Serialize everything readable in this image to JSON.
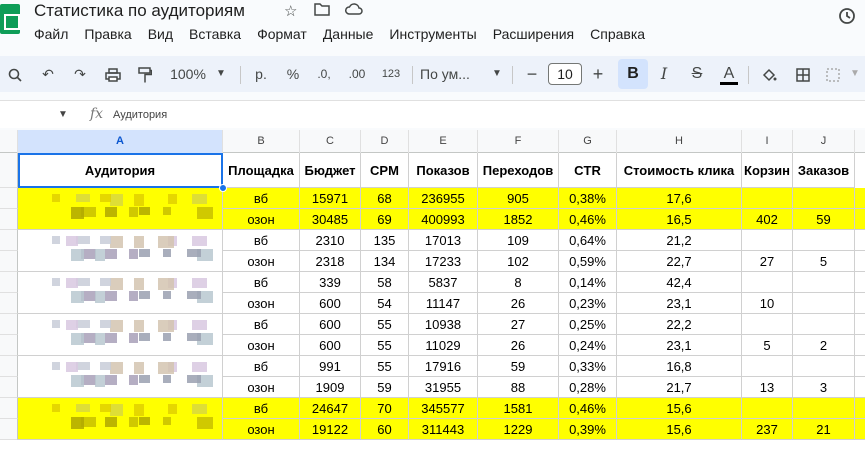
{
  "title": "Статистика по аудиториям",
  "menu": [
    "Файл",
    "Правка",
    "Вид",
    "Вставка",
    "Формат",
    "Данные",
    "Инструменты",
    "Расширения",
    "Справка"
  ],
  "toolbar": {
    "zoom": "100%",
    "currency": "р.",
    "percent": "%",
    "dec_decrease": ".0,",
    "dec_increase": ".00",
    "format_123": "123",
    "font": "По ум...",
    "font_size": "10",
    "bold": "B",
    "italic": "I",
    "strike": "S",
    "text_color": "A"
  },
  "formula_bar": {
    "value": "Аудитория"
  },
  "columns": [
    "A",
    "B",
    "C",
    "D",
    "E",
    "F",
    "G",
    "H",
    "I",
    "J"
  ],
  "selected_column": "A",
  "header_row": [
    "Аудитория",
    "Площадка",
    "Бюджет",
    "CPM",
    "Показов",
    "Переходов",
    "CTR",
    "Стоимость клика",
    "Корзин",
    "Заказов"
  ],
  "rows": [
    {
      "platform": "вб",
      "budget": "15971",
      "cpm": "68",
      "shows": "236955",
      "clicks": "905",
      "ctr": "0,38%",
      "cpc": "17,6",
      "carts": "",
      "orders": "",
      "highlight": true
    },
    {
      "platform": "озон",
      "budget": "30485",
      "cpm": "69",
      "shows": "400993",
      "clicks": "1852",
      "ctr": "0,46%",
      "cpc": "16,5",
      "carts": "402",
      "orders": "59",
      "highlight": true
    },
    {
      "platform": "вб",
      "budget": "2310",
      "cpm": "135",
      "shows": "17013",
      "clicks": "109",
      "ctr": "0,64%",
      "cpc": "21,2",
      "carts": "",
      "orders": "",
      "highlight": false
    },
    {
      "platform": "озон",
      "budget": "2318",
      "cpm": "134",
      "shows": "17233",
      "clicks": "102",
      "ctr": "0,59%",
      "cpc": "22,7",
      "carts": "27",
      "orders": "5",
      "highlight": false
    },
    {
      "platform": "вб",
      "budget": "339",
      "cpm": "58",
      "shows": "5837",
      "clicks": "8",
      "ctr": "0,14%",
      "cpc": "42,4",
      "carts": "",
      "orders": "",
      "highlight": false
    },
    {
      "platform": "озон",
      "budget": "600",
      "cpm": "54",
      "shows": "11147",
      "clicks": "26",
      "ctr": "0,23%",
      "cpc": "23,1",
      "carts": "10",
      "orders": "",
      "highlight": false
    },
    {
      "platform": "вб",
      "budget": "600",
      "cpm": "55",
      "shows": "10938",
      "clicks": "27",
      "ctr": "0,25%",
      "cpc": "22,2",
      "carts": "",
      "orders": "",
      "highlight": false
    },
    {
      "platform": "озон",
      "budget": "600",
      "cpm": "55",
      "shows": "11029",
      "clicks": "26",
      "ctr": "0,24%",
      "cpc": "23,1",
      "carts": "5",
      "orders": "2",
      "highlight": false
    },
    {
      "platform": "вб",
      "budget": "991",
      "cpm": "55",
      "shows": "17916",
      "clicks": "59",
      "ctr": "0,33%",
      "cpc": "16,8",
      "carts": "",
      "orders": "",
      "highlight": false
    },
    {
      "platform": "озон",
      "budget": "1909",
      "cpm": "59",
      "shows": "31955",
      "clicks": "88",
      "ctr": "0,28%",
      "cpc": "21,7",
      "carts": "13",
      "orders": "3",
      "highlight": false
    },
    {
      "platform": "вб",
      "budget": "24647",
      "cpm": "70",
      "shows": "345577",
      "clicks": "1581",
      "ctr": "0,46%",
      "cpc": "15,6",
      "carts": "",
      "orders": "",
      "highlight": true
    },
    {
      "platform": "озон",
      "budget": "19122",
      "cpm": "60",
      "shows": "311443",
      "clicks": "1229",
      "ctr": "0,39%",
      "cpc": "15,6",
      "carts": "237",
      "orders": "21",
      "highlight": true
    }
  ]
}
